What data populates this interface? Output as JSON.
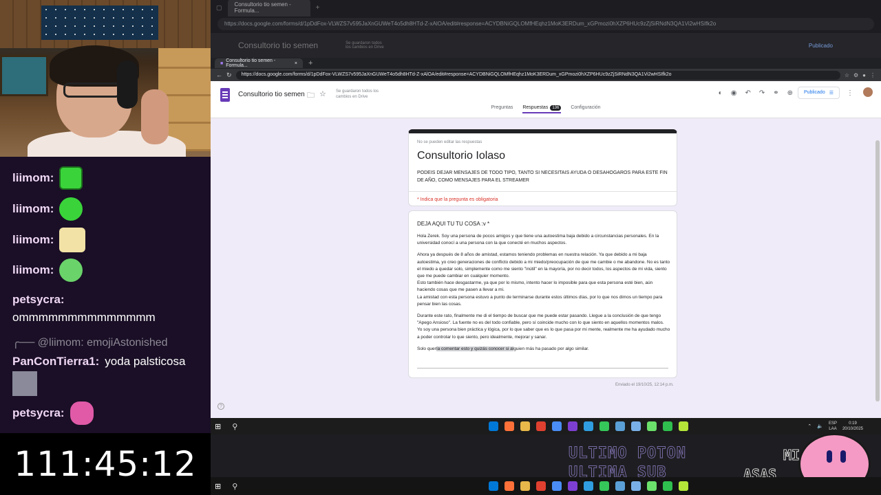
{
  "overlay": {
    "chat": [
      {
        "user": "liimom:",
        "emote_color": "#3ad43a",
        "emote": "angry-face-emote"
      },
      {
        "user": "liimom:",
        "emote_color": "#3ad43a",
        "emote": "smile-face-emote"
      },
      {
        "user": "liimom:",
        "emote_color": "#f2e2a6",
        "emote": "anime-face-emote"
      },
      {
        "user": "liimom:",
        "emote_color": "#6ad36a",
        "emote": "skull-emote"
      },
      {
        "user": "petsycra:",
        "text": "ommmmmmmmmmmmmm"
      },
      {
        "reply_to": "@liimom:",
        "reply_text": "emojiAstonished"
      },
      {
        "user": "PanConTierra1:",
        "text": "yoda palsticosa",
        "emote": "person-photo-emote"
      },
      {
        "user": "petsycra:",
        "emote": "pink-robot-emote",
        "emote_color": "#e05aa8"
      }
    ],
    "timer": "111:45:12",
    "banner_line1": "ULTIMO POTON",
    "banner_line2": "ULTIMA SUB",
    "side_text1": "MI",
    "side_text2": "ASAS"
  },
  "background_browser": {
    "tab_title": "Consultorio tio semen - Formula...",
    "url": "https://docs.google.com/forms/d/1pDdFox-VLWZS7v595JaXnGUWeT4o5dh8HTd-Z-xAlOA/edit#response=ACYDBNiGQLOMfHEqhz1MoK3ERDum_xGPmozi0hXZP6HUc9zZjSiRNdN3QA1Vi2wHSIfk2o",
    "form_title": "Consultorio tio semen",
    "saved": "Se guardaron todos los cambios en Drive",
    "published": "Publicado"
  },
  "browser": {
    "tab_title": "Consultorio tio semen - Formula...",
    "url": "https://docs.google.com/forms/d/1pDdFox-VLWZS7v595JaXnGUWeT4o5dh8HTd-Z-xAlOA/edit#response=ACYDBNiGQLOMfHEqhz1MoK3ERDum_xGPmozi0hXZP6HUc9zZjSiRNdN3QA1Vi2wHSIfk2o"
  },
  "form": {
    "title": "Consultorio tio semen",
    "saved_status": "Se guardaron todos los cambios en Drive",
    "tabs": {
      "preguntas": "Preguntas",
      "respuestas": "Respuestas",
      "respuestas_count": "136",
      "configuracion": "Configuración"
    },
    "published_label": "Publicado",
    "header_card": {
      "note": "No se pueden editar las respuestas",
      "title": "Consultorio Iolaso",
      "description": "PODEIS DEJAR MENSAJES DE TODO TIPO, TANTO SI NECESITAIS AYUDA O DESAHOGAROS PARA ESTE FIN DE AÑO, COMO MENSAJES PARA EL STREAMER",
      "required_note": "* Indica que la pregunta es obligatoria"
    },
    "question": {
      "label": "DEJA AQUI TU TU COSA :v *",
      "paragraphs": [
        "Hola Zerek. Soy una persona de pocos amigos y que tiene una autoestima baja debido a circunstancias personales. En la universidad conocí a una persona con la que conecté en muchos aspectos.",
        "Ahora ya después de 8 años de amistad, estamos teniendo problemas en nuestra relación. Ya que debido a mi baja autoestima, yo creo generaciones de conflicto debido a mi miedo/preocupación de que me cambie o me abandone. No es tanto el miedo a quedar solo, simplemente como me siento \"inútil\" en la mayoría, por no decir todos, los aspectos de mi vida, siento que me puede cambiar en cualquier momento.\nEsto también hace desgastarme, ya que por lo mismo, intento hacer lo imposible para que esta persona esté bien, aún haciendo cosas que me pasen a llevar a mi.\nLa amistad con esta persona estuvo a punto de terminarse durante estos últimos días, por lo que nos dimos un tiempo para pensar bien las cosas.",
        "Durante este rato, finalmente me di el tiempo de buscar que me puede estar pasando. Llegue a la conclusión de que tengo \"Apego Ansioso\". La fuente no es del todo confiable, pero sí coincide mucho con lo que siento en aquellos momentos malos.\nYo soy una persona bien práctica y lógica, por lo que saber que es lo que pasa por mi mente, realmente me ha ayudado mucho a poder controlar lo que siento, pero idealmente, mejorar y sanar."
      ],
      "last_prefix": "Solo quer",
      "last_highlight": "ía comentar esto y quizás conocer si al",
      "last_suffix": "guien más ha pasado por algo similar."
    },
    "sent_at": "Enviado el 19/10/25, 12:14 p.m."
  },
  "taskbar": {
    "lang": "ESP",
    "lang2": "LAA",
    "time": "0:19",
    "date": "20/10/2025",
    "apps": [
      "#0078d7",
      "#ff7139",
      "#e8b84a",
      "#e0402f",
      "#4a8df6",
      "#7d3fd1",
      "#2f9de0",
      "#35c759",
      "#5a9fd6",
      "#7ab0e8",
      "#6be06b",
      "#2fbf4f",
      "#b3e639"
    ]
  }
}
